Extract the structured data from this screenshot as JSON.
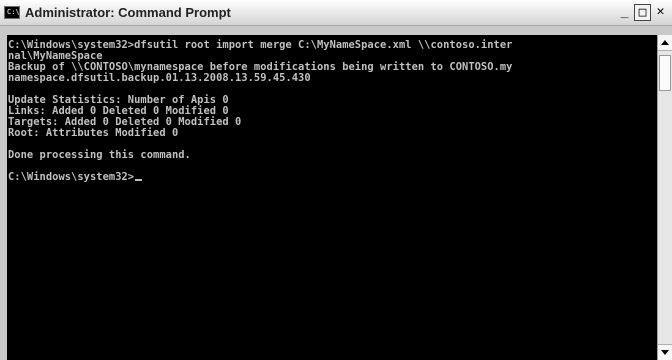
{
  "window": {
    "title": "Administrator: Command Prompt",
    "icon_name": "command-prompt-icon",
    "icon_glyph": "C:\\.",
    "minimize_glyph": "_",
    "maximize_glyph": "□",
    "close_glyph": "✕"
  },
  "console": {
    "lines": [
      "C:\\Windows\\system32>dfsutil root import merge C:\\MyNameSpace.xml \\\\contoso.inter",
      "nal\\MyNameSpace",
      "Backup of \\\\CONTOSO\\mynamespace before modifications being written to CONTOSO.my",
      "namespace.dfsutil.backup.01.13.2008.13.59.45.430",
      "",
      "Update Statistics: Number of Apis 0",
      "Links: Added 0 Deleted 0 Modified 0",
      "Targets: Added 0 Deleted 0 Modified 0",
      "Root: Attributes Modified 0",
      "",
      "Done processing this command.",
      "",
      "C:\\Windows\\system32>"
    ],
    "text_color": "#c0c0c0",
    "background_color": "#000000"
  }
}
